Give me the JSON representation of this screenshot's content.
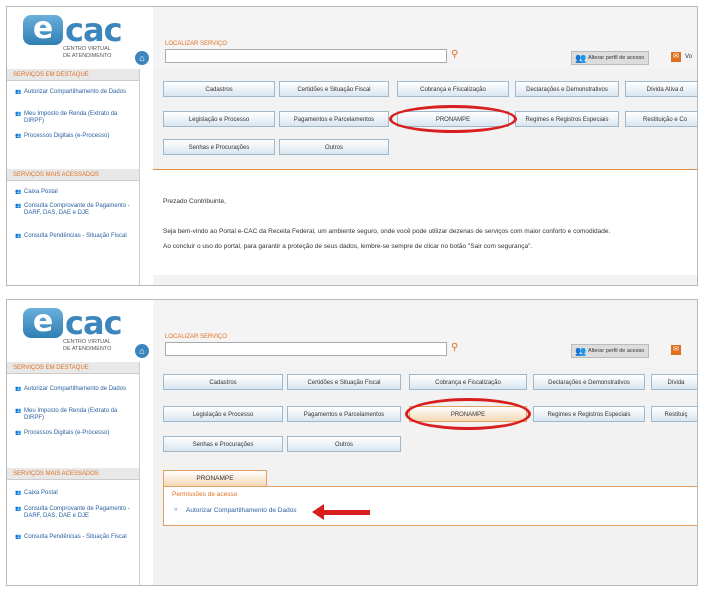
{
  "logo": {
    "brand": "cac",
    "brand_e": "e",
    "sub1": "CENTRO VIRTUAL",
    "sub2": "DE ATENDIMENTO"
  },
  "header": {
    "search_label": "LOCALIZAR SERVIÇO",
    "search_value": "",
    "profile_button": "Alterar perfil de acesso",
    "messages_label": "Vo"
  },
  "sidebar": {
    "featured_title": "SERVIÇOS EM DESTAQUE",
    "featured_items": [
      "Autorizar Compartilhamento de Dados",
      "Meu Imposto de Renda (Extrato da DIRPF)",
      "Processos Digitais (e-Processo)"
    ],
    "most_accessed_title": "SERVIÇOS MAIS ACESSADOS",
    "most_accessed_items": [
      "Caixa Postal",
      "Consulta Comprovante de Pagamento - DARF, DAS, DAE e DJE",
      "Consulta Pendências - Situação Fiscal"
    ]
  },
  "categories": {
    "row1": [
      "Cadastros",
      "Certidões e Situação Fiscal",
      "Cobrança e Fiscalização",
      "Declarações e Demonstrativos",
      "Dívida Ativa d"
    ],
    "row2": [
      "Legislação e Processo",
      "Pagamentos e Parcelamentos",
      "PRONAMPE",
      "Regimes e Registros Especiais",
      "Restituição e Co"
    ],
    "row3": [
      "Senhas e Procurações",
      "Outros"
    ],
    "p2_row1": [
      "Cadastros",
      "Certidões e Situação Fiscal",
      "Cobrança e Fiscalização",
      "Declarações e Demonstrativos",
      "Dívida"
    ],
    "p2_row2": [
      "Legislação e Processo",
      "Pagamentos e Parcelamentos",
      "PRONAMPE",
      "Regimes e Registros Especiais",
      "Restituiç"
    ]
  },
  "welcome": {
    "greeting": "Prezado Contribuinte,",
    "line1": "Seja bem-vindo ao Portal e-CAC da Receita Federal, um ambiente seguro, onde você pode utilizar dezenas de serviços com maior conforto e comodidade.",
    "line2": "Ao concluir o uso do portal, para garantir a proteção de seus dados, lembre-se sempre de clicar no botão \"Sair com segurança\"."
  },
  "pronampe": {
    "tab": "PRONAMPE",
    "permissions_title": "Permissões de acesso",
    "permission_item": "Autorizar Compartilhamento de Dados"
  },
  "icons": {
    "search": "search-icon",
    "home": "home-icon",
    "profile": "people-icon",
    "messages": "mail-icon"
  },
  "colors": {
    "accent": "#e07020",
    "link": "#2a5fa0",
    "highlight": "#d81e1e",
    "brand": "#3c86bd"
  }
}
